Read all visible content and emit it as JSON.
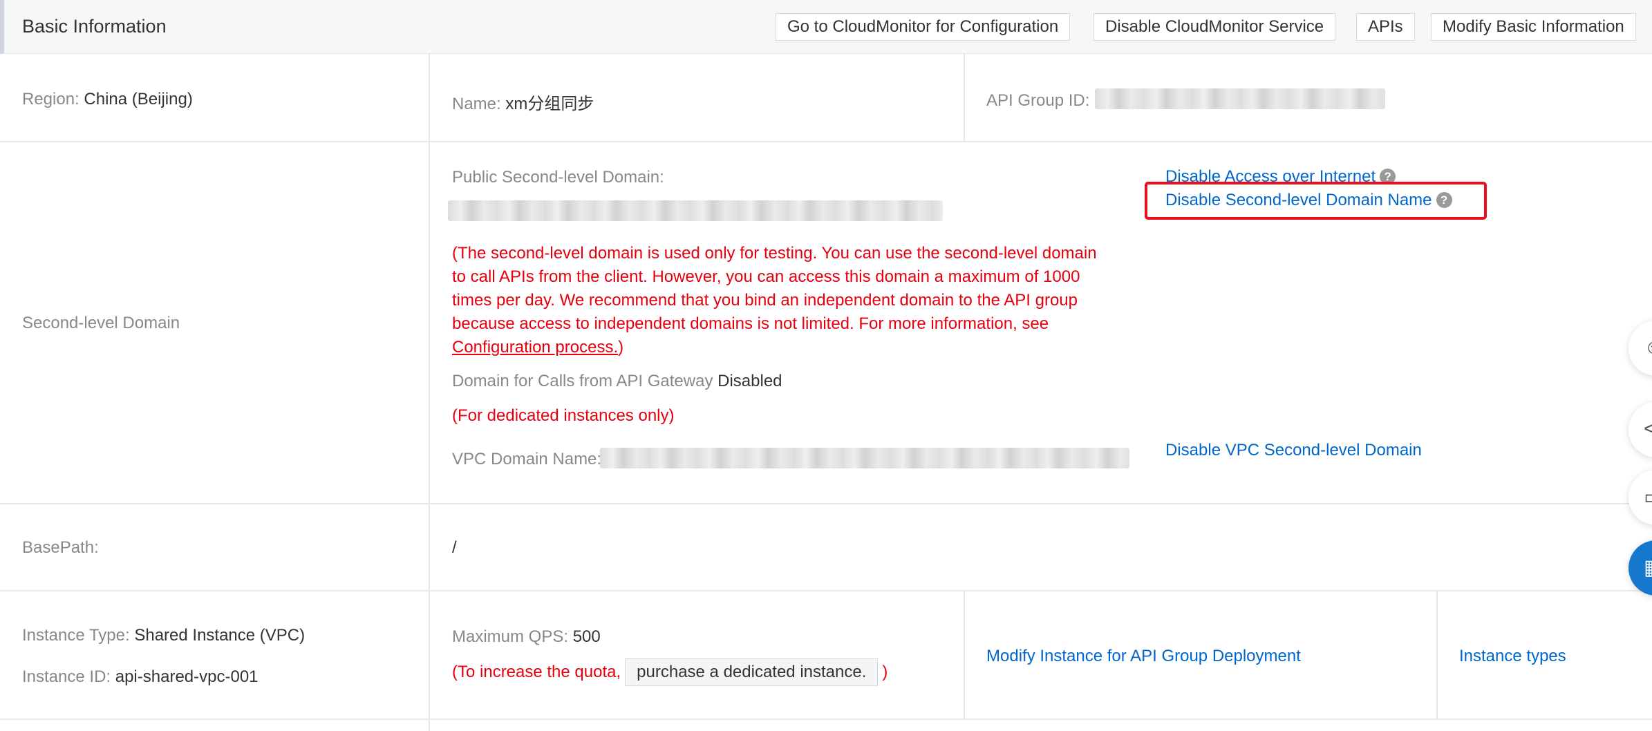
{
  "header": {
    "title": "Basic Information",
    "buttons": {
      "cloudmonitor_config": "Go to CloudMonitor for Configuration",
      "disable_cloudmonitor": "Disable CloudMonitor Service",
      "apis": "APIs",
      "modify_basic": "Modify Basic Information"
    }
  },
  "row1": {
    "region_label": "Region:",
    "region_value": "China (Beijing)",
    "name_label": "Name:",
    "name_value": "xm分组同步",
    "group_id_label": "API Group ID:"
  },
  "domain": {
    "section_label": "Second-level Domain",
    "public_label": "Public Second-level Domain:",
    "disable_internet": "Disable Access over Internet",
    "disable_second_level": "Disable Second-level Domain Name",
    "help_glyph": "?",
    "note_text": "(The second-level domain is used only for testing. You can use the second-level domain to call APIs from the client. However, you can access this domain a maximum of 1000 times per day. We recommend that you bind an independent domain to the API group because access to independent domains is not limited. For more information, see ",
    "note_link": "Configuration process.",
    "note_close": ")",
    "gateway_label": "Domain for Calls from API Gateway",
    "gateway_value": "Disabled",
    "dedicated_note": "(For dedicated instances only)",
    "vpc_label": "VPC Domain Name:",
    "disable_vpc": "Disable VPC Second-level Domain"
  },
  "basepath": {
    "label": "BasePath:",
    "value": "/"
  },
  "instance": {
    "type_label": "Instance Type:",
    "type_value": "Shared Instance (VPC)",
    "id_label": "Instance ID:",
    "id_value": "api-shared-vpc-001",
    "qps_label": "Maximum QPS:",
    "qps_value": "500",
    "quota_prefix": "(To increase the quota,",
    "purchase_button": "purchase a dedicated instance.",
    "quota_suffix": ")",
    "modify_deployment": "Modify Instance for API Group Deployment",
    "instance_types": "Instance types"
  },
  "floating_tools": [
    {
      "icon": "chat-icon",
      "glyph": "☺"
    },
    {
      "icon": "share-icon",
      "glyph": "<"
    },
    {
      "icon": "document-icon",
      "glyph": "▭"
    },
    {
      "icon": "apps-grid-icon",
      "glyph": "▦"
    }
  ],
  "colors": {
    "link": "#0066cc",
    "warning": "#e6000e",
    "highlight": "#e8101c"
  }
}
